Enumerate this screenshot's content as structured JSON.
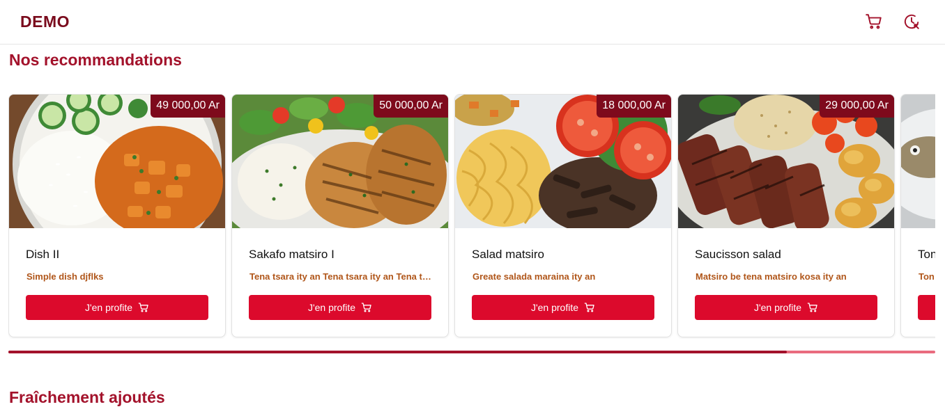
{
  "header": {
    "logo": "DEMO",
    "cart_icon": "cart-icon",
    "history_icon": "clock-history-icon"
  },
  "sections": {
    "recommendations_title": "Nos recommandations",
    "fresh_title": "Fraîchement ajoutés"
  },
  "cards": [
    {
      "name": "Dish II",
      "price": "49 000,00 Ar",
      "description": "Simple dish djflks",
      "button_label": "J'en profite",
      "image": "curry-rice"
    },
    {
      "name": "Sakafo matsiro I",
      "price": "50 000,00 Ar",
      "description": "Tena tsara ity an Tena tsara ity an Tena tsara ity an",
      "button_label": "J'en profite",
      "image": "grilled-chicken-rice"
    },
    {
      "name": "Salad matsiro",
      "price": "18 000,00 Ar",
      "description": "Greate salada maraina ity an",
      "button_label": "J'en profite",
      "image": "pasta-beef-tomato"
    },
    {
      "name": "Saucisson salad",
      "price": "29 000,00 Ar",
      "description": "Matsiro be tena matsiro kosa ity an",
      "button_label": "J'en profite",
      "image": "steak-rice-potatoes"
    },
    {
      "name": "Ton",
      "price": "",
      "description": "Ton",
      "button_label": "",
      "image": "fish"
    }
  ],
  "carousel_progress": 0.84,
  "colors": {
    "brand": "#7a0b1d",
    "accent": "#dc0a2c",
    "title": "#a3122b",
    "description": "#b0561a"
  }
}
